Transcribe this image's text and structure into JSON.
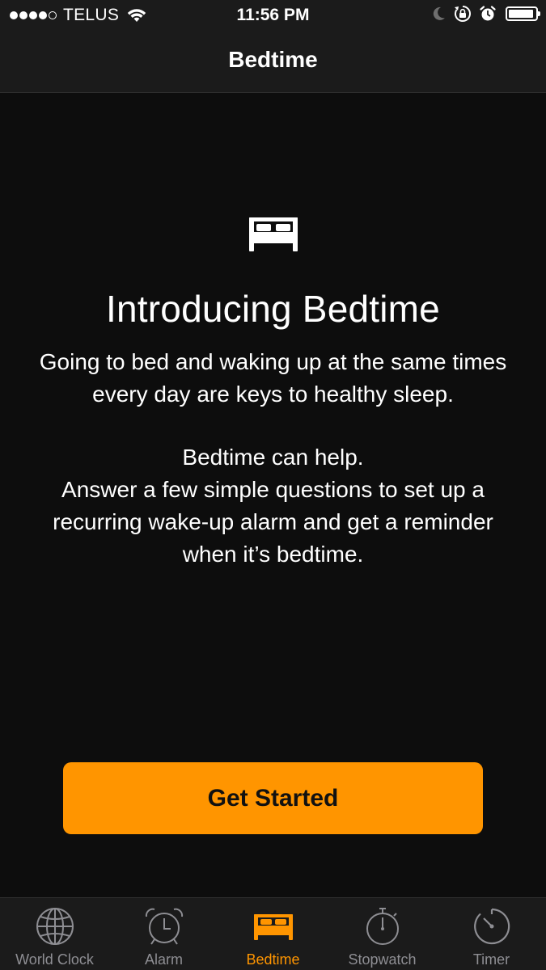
{
  "status_bar": {
    "carrier": "TELUS",
    "time": "11:56 PM",
    "signal_bars_filled": 4,
    "signal_bars_total": 5,
    "battery_level": 0.95,
    "icons": [
      "signal-dots-icon",
      "wifi-icon",
      "moon-icon",
      "orientation-lock-icon",
      "alarm-icon",
      "battery-icon"
    ]
  },
  "nav": {
    "title": "Bedtime"
  },
  "intro": {
    "icon": "bed-icon",
    "title": "Introducing Bedtime",
    "paragraph1": "Going to bed and waking up at the same times every day are keys to healthy sleep.",
    "line1": "Bedtime can help.",
    "line2": "Answer a few simple questions to set up a recurring wake-up alarm and get a reminder when it’s bedtime."
  },
  "button": {
    "label": "Get Started"
  },
  "tabs": [
    {
      "label": "World Clock",
      "icon": "globe-icon",
      "active": false
    },
    {
      "label": "Alarm",
      "icon": "alarm-clock-icon",
      "active": false
    },
    {
      "label": "Bedtime",
      "icon": "bed-icon",
      "active": true
    },
    {
      "label": "Stopwatch",
      "icon": "stopwatch-icon",
      "active": false
    },
    {
      "label": "Timer",
      "icon": "timer-icon",
      "active": false
    }
  ],
  "colors": {
    "accent": "#ff9500",
    "background": "#0d0d0d",
    "bar_background": "#1b1b1b",
    "inactive_tab": "#8e8e93"
  }
}
